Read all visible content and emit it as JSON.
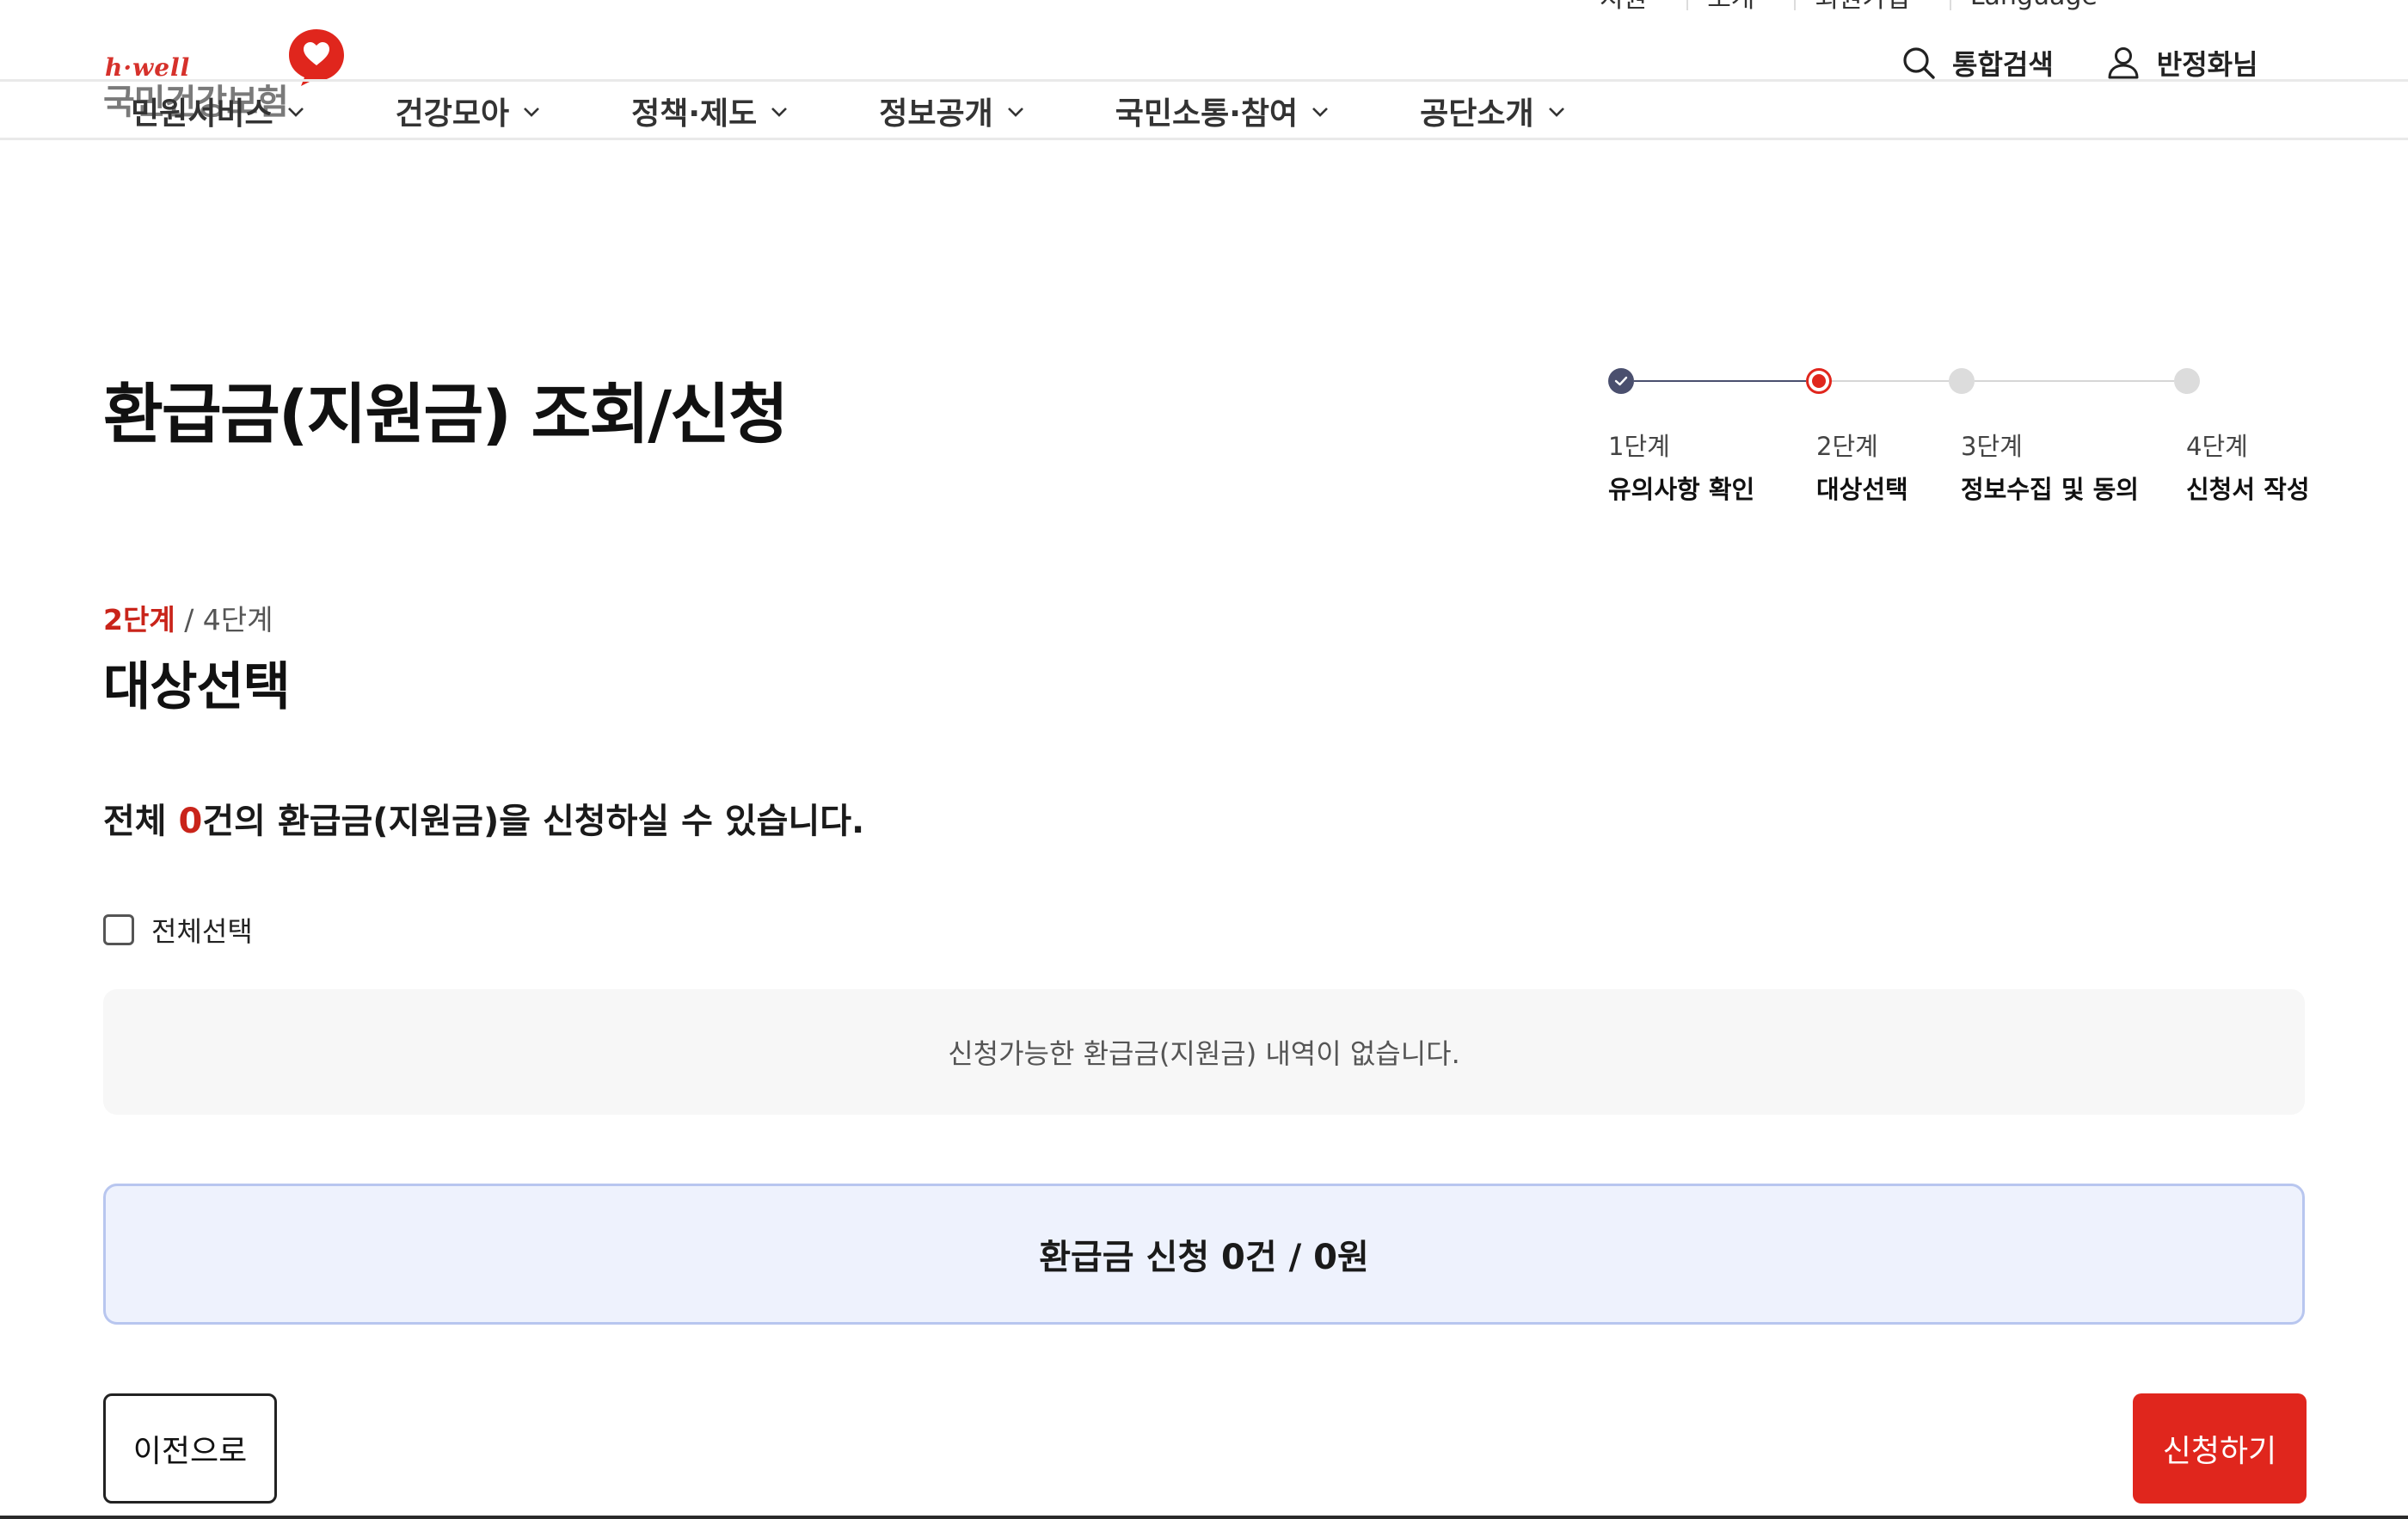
{
  "colors": {
    "brand_red": "#e0261d",
    "accent_red_text": "#c9241a",
    "step_done": "#4a4f6e",
    "step_todo": "#dcdcdc",
    "total_box_bg": "#eef2fd",
    "total_box_border": "#b8c6ef",
    "empty_box_bg": "#f7f7f7"
  },
  "header": {
    "logo": {
      "tagline": "h·well",
      "name": "국민건강보험",
      "icon": "heart-speech-bubble-icon"
    },
    "util_links": [
      {
        "label": "지원",
        "icon": "chevron-down-icon"
      },
      {
        "label": "소개",
        "icon": "chevron-down-icon"
      },
      {
        "label": "회원가입",
        "icon": "chevron-down-icon"
      },
      {
        "label": "Language",
        "icon": "chevron-down-icon"
      }
    ],
    "search_label": "통합검색",
    "user_label": "반정화님"
  },
  "nav": {
    "items": [
      {
        "label": "민원서비스"
      },
      {
        "label": "건강모아"
      },
      {
        "label": "정책·제도"
      },
      {
        "label": "정보공개"
      },
      {
        "label": "국민소통·참여"
      },
      {
        "label": "공단소개"
      }
    ]
  },
  "page": {
    "title": "환급금(지원금) 조회/신청"
  },
  "stepper": {
    "steps": [
      {
        "num": "1단계",
        "label": "유의사항 확인",
        "state": "done"
      },
      {
        "num": "2단계",
        "label": "대상선택",
        "state": "current"
      },
      {
        "num": "3단계",
        "label": "정보수집 및 동의",
        "state": "todo"
      },
      {
        "num": "4단계",
        "label": "신청서 작성",
        "state": "todo"
      }
    ]
  },
  "section": {
    "current_step": "2단계",
    "total_steps": "/ 4단계",
    "title": "대상선택",
    "summary_prefix": "전체 ",
    "summary_count": "0",
    "summary_suffix": "건의 환급금(지원금)을 신청하실 수 있습니다.",
    "select_all_label": "전체선택",
    "select_all_checked": false,
    "empty_message": "신청가능한 환급금(지원금) 내역이 없습니다.",
    "total_label": "환급금 신청 0건 / 0원"
  },
  "buttons": {
    "prev_label": "이전으로",
    "apply_label": "신청하기"
  }
}
